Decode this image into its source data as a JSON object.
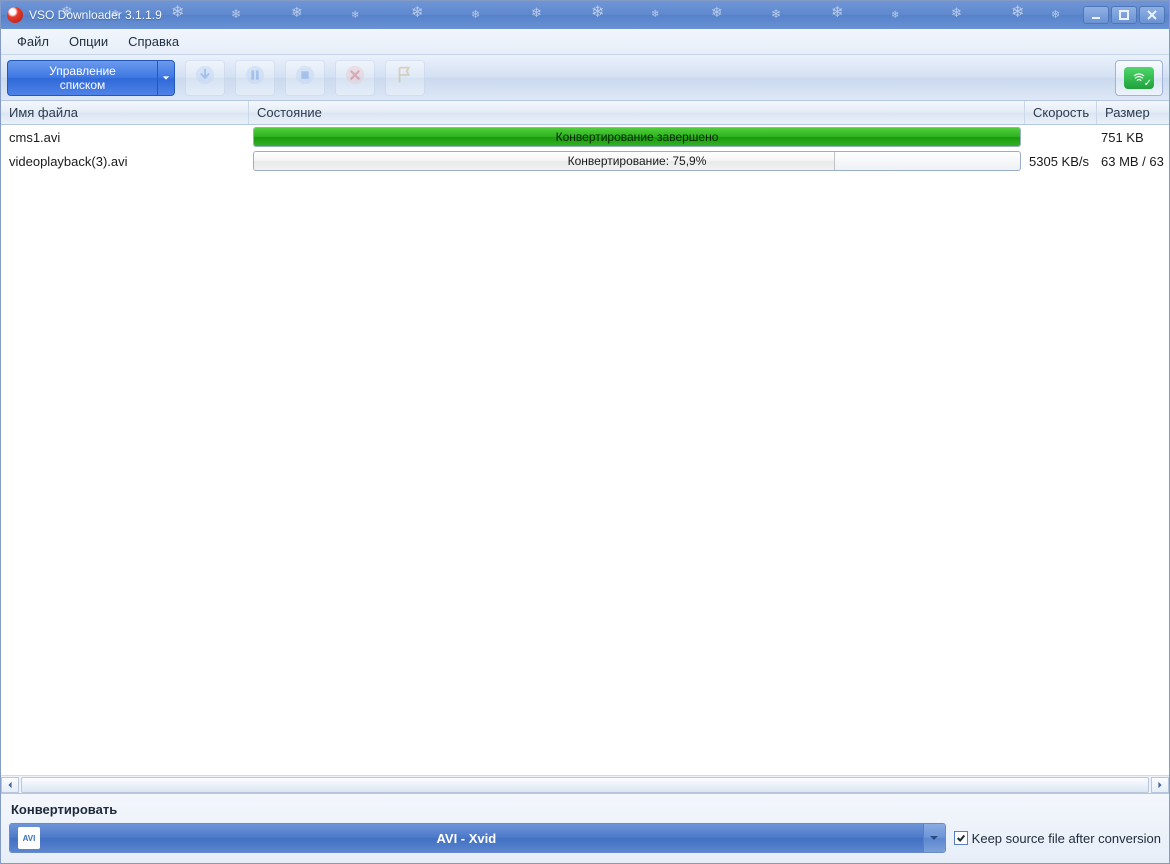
{
  "window": {
    "title": "VSO Downloader 3.1.1.9"
  },
  "menu": {
    "file": "Файл",
    "options": "Опции",
    "help": "Справка"
  },
  "toolbar": {
    "list_management": "Управление\nсписком"
  },
  "columns": {
    "name": "Имя файла",
    "state": "Состояние",
    "speed": "Скорость",
    "size": "Размер"
  },
  "rows": [
    {
      "name": "cms1.avi",
      "state_label": "Конвертирование завершено",
      "progress_pct": 100,
      "complete": true,
      "speed": "",
      "size": "751 KB"
    },
    {
      "name": "videoplayback(3).avi",
      "state_label": "Конвертирование: 75,9%",
      "progress_pct": 75.9,
      "complete": false,
      "speed": "5305 KB/s",
      "size": "63 MB / 63"
    }
  ],
  "convert": {
    "title": "Конвертировать",
    "format_label": "AVI - Xvid",
    "format_icon": "AVI",
    "keep_source_label": "Keep source file after conversion",
    "keep_source_checked": true
  }
}
